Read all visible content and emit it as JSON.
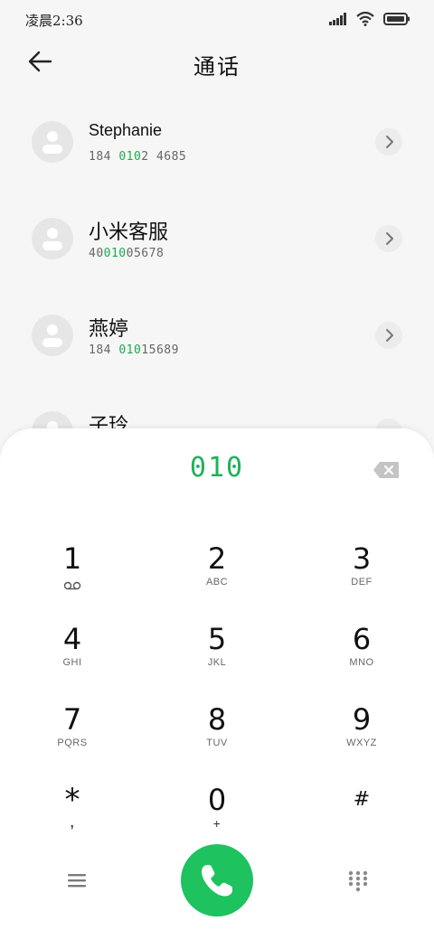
{
  "status_bar": {
    "time": "凌晨2:36"
  },
  "header": {
    "title": "通话"
  },
  "contacts": [
    {
      "name": "Stephanie",
      "number_pre": "184 ",
      "number_match": "010",
      "number_post": "2 4685"
    },
    {
      "name": "小米客服",
      "number_pre": "40",
      "number_match": "010",
      "number_post": "05678"
    },
    {
      "name": "燕婷",
      "number_pre": "184 ",
      "number_match": "010",
      "number_post": "15689"
    },
    {
      "name": "子玲",
      "number_pre": "",
      "number_match": "",
      "number_post": ""
    }
  ],
  "dialpad": {
    "input": "010",
    "keys": [
      {
        "digit": "1",
        "letters": ""
      },
      {
        "digit": "2",
        "letters": "ABC"
      },
      {
        "digit": "3",
        "letters": "DEF"
      },
      {
        "digit": "4",
        "letters": "GHI"
      },
      {
        "digit": "5",
        "letters": "JKL"
      },
      {
        "digit": "6",
        "letters": "MNO"
      },
      {
        "digit": "7",
        "letters": "PQRS"
      },
      {
        "digit": "8",
        "letters": "TUV"
      },
      {
        "digit": "9",
        "letters": "WXYZ"
      },
      {
        "digit": "*",
        "letters": ","
      },
      {
        "digit": "0",
        "letters": "+"
      },
      {
        "digit": "#",
        "letters": ""
      }
    ]
  },
  "colors": {
    "accent": "#1fb15a",
    "call_button": "#1ec25f",
    "background": "#f6f6f6"
  },
  "icons": {
    "back": "arrow-left-icon",
    "voicemail": "voicemail-icon",
    "backspace": "backspace-icon",
    "call": "phone-icon",
    "menu": "menu-icon",
    "keypad": "dialpad-icon"
  }
}
